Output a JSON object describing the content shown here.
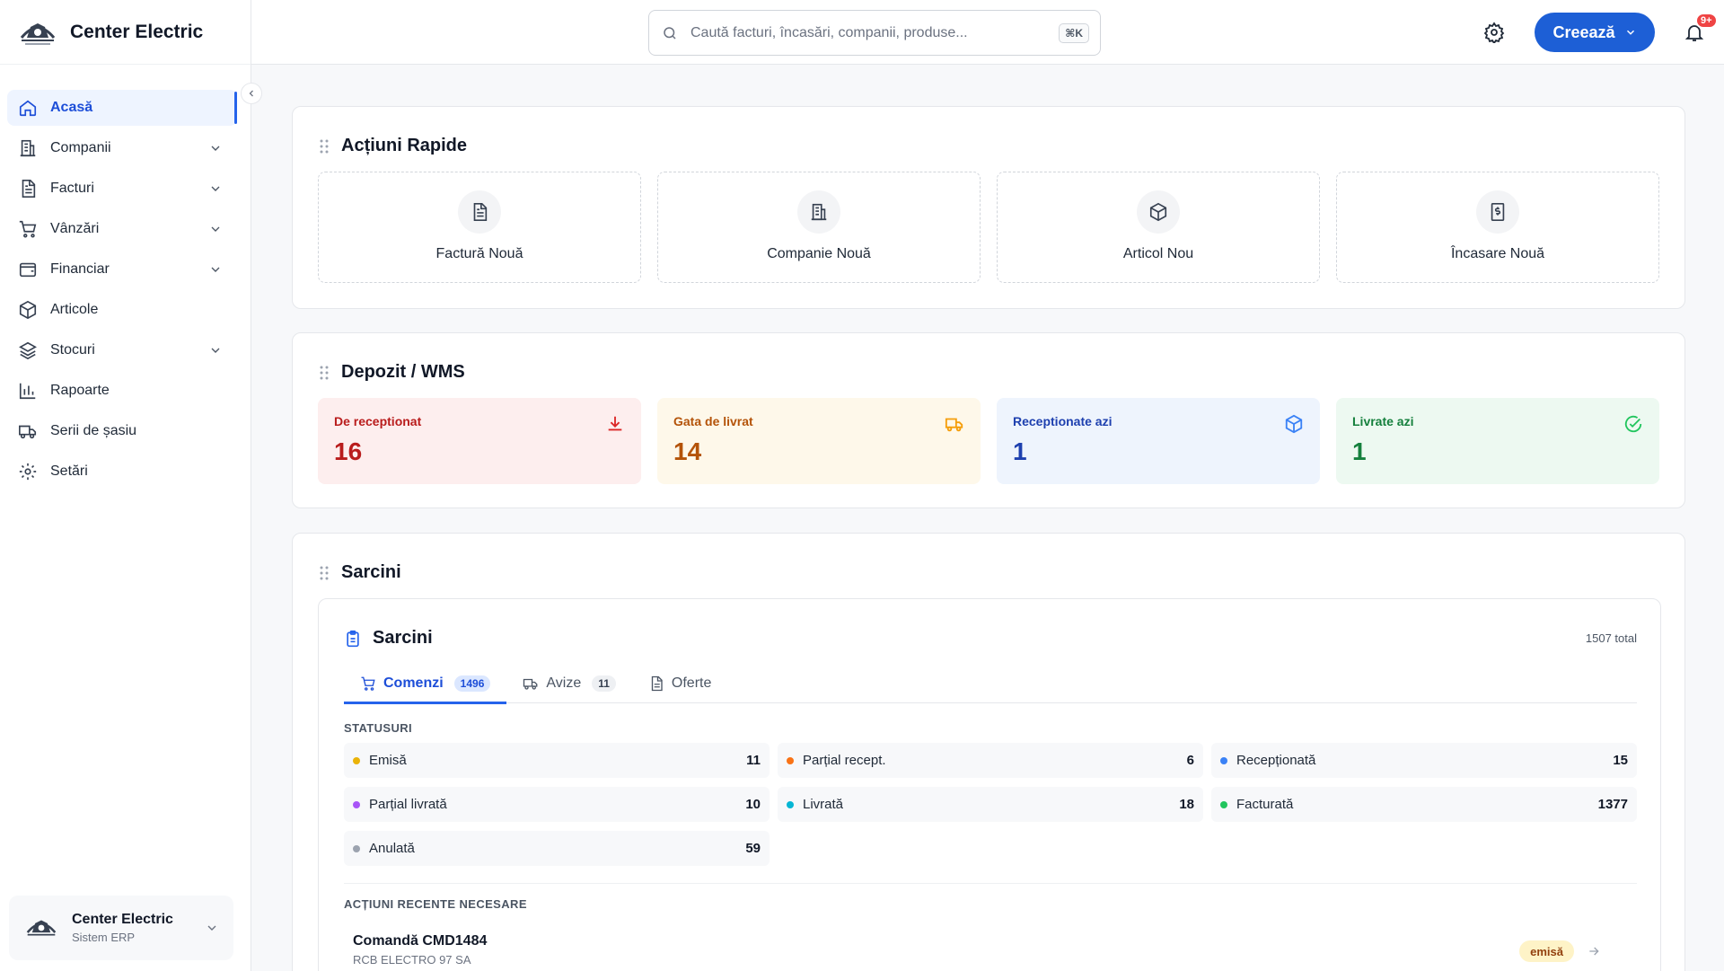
{
  "app": {
    "name": "Center Electric"
  },
  "colors": {
    "accent": "#1d5fd6",
    "sidebar_active_bg": "#eef4ff"
  },
  "sidebar": {
    "items": [
      {
        "label": "Acasă",
        "icon": "home-icon",
        "active": true,
        "expandable": false
      },
      {
        "label": "Companii",
        "icon": "building-icon",
        "active": false,
        "expandable": true
      },
      {
        "label": "Facturi",
        "icon": "document-icon",
        "active": false,
        "expandable": true
      },
      {
        "label": "Vânzări",
        "icon": "cart-icon",
        "active": false,
        "expandable": true
      },
      {
        "label": "Financiar",
        "icon": "wallet-icon",
        "active": false,
        "expandable": true
      },
      {
        "label": "Articole",
        "icon": "box-icon",
        "active": false,
        "expandable": false
      },
      {
        "label": "Stocuri",
        "icon": "layers-icon",
        "active": false,
        "expandable": true
      },
      {
        "label": "Rapoarte",
        "icon": "bar-chart-icon",
        "active": false,
        "expandable": false
      },
      {
        "label": "Serii de șasiu",
        "icon": "truck-icon",
        "active": false,
        "expandable": false
      },
      {
        "label": "Setări",
        "icon": "gear-icon",
        "active": false,
        "expandable": false
      }
    ],
    "company": {
      "name": "Center Electric",
      "subtitle": "Sistem ERP"
    }
  },
  "header": {
    "search": {
      "placeholder": "Caută facturi, încasări, companii, produse...",
      "value": "",
      "shortcut": "⌘K"
    },
    "create_label": "Creează",
    "notifications_badge": "9+"
  },
  "quick_actions": {
    "title": "Acțiuni Rapide",
    "items": [
      {
        "label": "Factură Nouă",
        "icon": "document-icon"
      },
      {
        "label": "Companie Nouă",
        "icon": "building-icon"
      },
      {
        "label": "Articol Nou",
        "icon": "box-icon"
      },
      {
        "label": "Încasare Nouă",
        "icon": "receipt-icon"
      }
    ]
  },
  "warehouse": {
    "title": "Depozit / WMS",
    "cards": [
      {
        "label": "De receptionat",
        "value": "16",
        "icon": "download-icon",
        "bg": "#fdeeee",
        "color": "#b91c1c"
      },
      {
        "label": "Gata de livrat",
        "value": "14",
        "icon": "truck-icon",
        "bg": "#fef8ea",
        "color": "#b45309"
      },
      {
        "label": "Receptionate azi",
        "value": "1",
        "icon": "box-icon",
        "bg": "#eef4fd",
        "color": "#1e40af"
      },
      {
        "label": "Livrate azi",
        "value": "1",
        "icon": "check-circle-icon",
        "bg": "#edf9f1",
        "color": "#15803d"
      }
    ]
  },
  "tasks": {
    "section_title": "Sarcini",
    "card_title": "Sarcini",
    "total": "1507 total",
    "tabs": [
      {
        "label": "Comenzi",
        "count": "1496",
        "icon": "cart-icon",
        "active": true
      },
      {
        "label": "Avize",
        "count": "11",
        "icon": "truck-icon",
        "active": false
      },
      {
        "label": "Oferte",
        "count": "",
        "icon": "document-icon",
        "active": false
      }
    ],
    "statuses_label": "STATUSURI",
    "statuses": [
      {
        "label": "Emisă",
        "count": "11",
        "color": "#eab308"
      },
      {
        "label": "Parțial recept.",
        "count": "6",
        "color": "#f97316"
      },
      {
        "label": "Recepționată",
        "count": "15",
        "color": "#3b82f6"
      },
      {
        "label": "Parțial livrată",
        "count": "10",
        "color": "#a855f7"
      },
      {
        "label": "Livrată",
        "count": "18",
        "color": "#06b6d4"
      },
      {
        "label": "Facturată",
        "count": "1377",
        "color": "#22c55e"
      },
      {
        "label": "Anulată",
        "count": "59",
        "color": "#9ca3af"
      }
    ],
    "recent_label": "ACȚIUNI RECENTE NECESARE",
    "recent": [
      {
        "title": "Comandă CMD1484",
        "subtitle": "RCB ELECTRO 97 SA",
        "badge": "emisă"
      }
    ]
  }
}
